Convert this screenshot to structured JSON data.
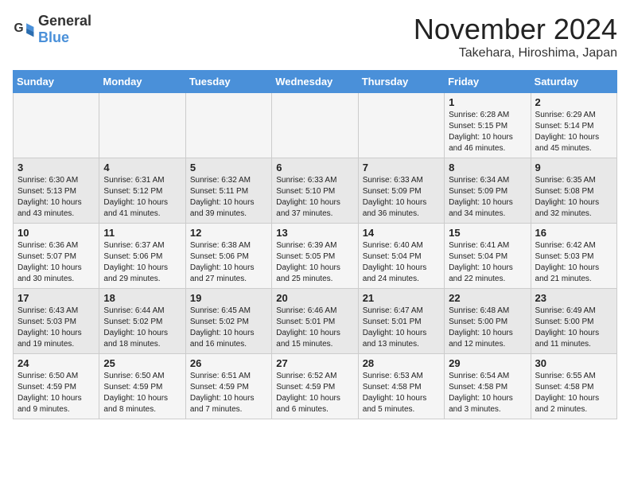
{
  "logo": {
    "general": "General",
    "blue": "Blue"
  },
  "header": {
    "month": "November 2024",
    "location": "Takehara, Hiroshima, Japan"
  },
  "weekdays": [
    "Sunday",
    "Monday",
    "Tuesday",
    "Wednesday",
    "Thursday",
    "Friday",
    "Saturday"
  ],
  "weeks": [
    [
      {
        "day": "",
        "info": ""
      },
      {
        "day": "",
        "info": ""
      },
      {
        "day": "",
        "info": ""
      },
      {
        "day": "",
        "info": ""
      },
      {
        "day": "",
        "info": ""
      },
      {
        "day": "1",
        "info": "Sunrise: 6:28 AM\nSunset: 5:15 PM\nDaylight: 10 hours and 46 minutes."
      },
      {
        "day": "2",
        "info": "Sunrise: 6:29 AM\nSunset: 5:14 PM\nDaylight: 10 hours and 45 minutes."
      }
    ],
    [
      {
        "day": "3",
        "info": "Sunrise: 6:30 AM\nSunset: 5:13 PM\nDaylight: 10 hours and 43 minutes."
      },
      {
        "day": "4",
        "info": "Sunrise: 6:31 AM\nSunset: 5:12 PM\nDaylight: 10 hours and 41 minutes."
      },
      {
        "day": "5",
        "info": "Sunrise: 6:32 AM\nSunset: 5:11 PM\nDaylight: 10 hours and 39 minutes."
      },
      {
        "day": "6",
        "info": "Sunrise: 6:33 AM\nSunset: 5:10 PM\nDaylight: 10 hours and 37 minutes."
      },
      {
        "day": "7",
        "info": "Sunrise: 6:33 AM\nSunset: 5:09 PM\nDaylight: 10 hours and 36 minutes."
      },
      {
        "day": "8",
        "info": "Sunrise: 6:34 AM\nSunset: 5:09 PM\nDaylight: 10 hours and 34 minutes."
      },
      {
        "day": "9",
        "info": "Sunrise: 6:35 AM\nSunset: 5:08 PM\nDaylight: 10 hours and 32 minutes."
      }
    ],
    [
      {
        "day": "10",
        "info": "Sunrise: 6:36 AM\nSunset: 5:07 PM\nDaylight: 10 hours and 30 minutes."
      },
      {
        "day": "11",
        "info": "Sunrise: 6:37 AM\nSunset: 5:06 PM\nDaylight: 10 hours and 29 minutes."
      },
      {
        "day": "12",
        "info": "Sunrise: 6:38 AM\nSunset: 5:06 PM\nDaylight: 10 hours and 27 minutes."
      },
      {
        "day": "13",
        "info": "Sunrise: 6:39 AM\nSunset: 5:05 PM\nDaylight: 10 hours and 25 minutes."
      },
      {
        "day": "14",
        "info": "Sunrise: 6:40 AM\nSunset: 5:04 PM\nDaylight: 10 hours and 24 minutes."
      },
      {
        "day": "15",
        "info": "Sunrise: 6:41 AM\nSunset: 5:04 PM\nDaylight: 10 hours and 22 minutes."
      },
      {
        "day": "16",
        "info": "Sunrise: 6:42 AM\nSunset: 5:03 PM\nDaylight: 10 hours and 21 minutes."
      }
    ],
    [
      {
        "day": "17",
        "info": "Sunrise: 6:43 AM\nSunset: 5:03 PM\nDaylight: 10 hours and 19 minutes."
      },
      {
        "day": "18",
        "info": "Sunrise: 6:44 AM\nSunset: 5:02 PM\nDaylight: 10 hours and 18 minutes."
      },
      {
        "day": "19",
        "info": "Sunrise: 6:45 AM\nSunset: 5:02 PM\nDaylight: 10 hours and 16 minutes."
      },
      {
        "day": "20",
        "info": "Sunrise: 6:46 AM\nSunset: 5:01 PM\nDaylight: 10 hours and 15 minutes."
      },
      {
        "day": "21",
        "info": "Sunrise: 6:47 AM\nSunset: 5:01 PM\nDaylight: 10 hours and 13 minutes."
      },
      {
        "day": "22",
        "info": "Sunrise: 6:48 AM\nSunset: 5:00 PM\nDaylight: 10 hours and 12 minutes."
      },
      {
        "day": "23",
        "info": "Sunrise: 6:49 AM\nSunset: 5:00 PM\nDaylight: 10 hours and 11 minutes."
      }
    ],
    [
      {
        "day": "24",
        "info": "Sunrise: 6:50 AM\nSunset: 4:59 PM\nDaylight: 10 hours and 9 minutes."
      },
      {
        "day": "25",
        "info": "Sunrise: 6:50 AM\nSunset: 4:59 PM\nDaylight: 10 hours and 8 minutes."
      },
      {
        "day": "26",
        "info": "Sunrise: 6:51 AM\nSunset: 4:59 PM\nDaylight: 10 hours and 7 minutes."
      },
      {
        "day": "27",
        "info": "Sunrise: 6:52 AM\nSunset: 4:59 PM\nDaylight: 10 hours and 6 minutes."
      },
      {
        "day": "28",
        "info": "Sunrise: 6:53 AM\nSunset: 4:58 PM\nDaylight: 10 hours and 5 minutes."
      },
      {
        "day": "29",
        "info": "Sunrise: 6:54 AM\nSunset: 4:58 PM\nDaylight: 10 hours and 3 minutes."
      },
      {
        "day": "30",
        "info": "Sunrise: 6:55 AM\nSunset: 4:58 PM\nDaylight: 10 hours and 2 minutes."
      }
    ]
  ]
}
